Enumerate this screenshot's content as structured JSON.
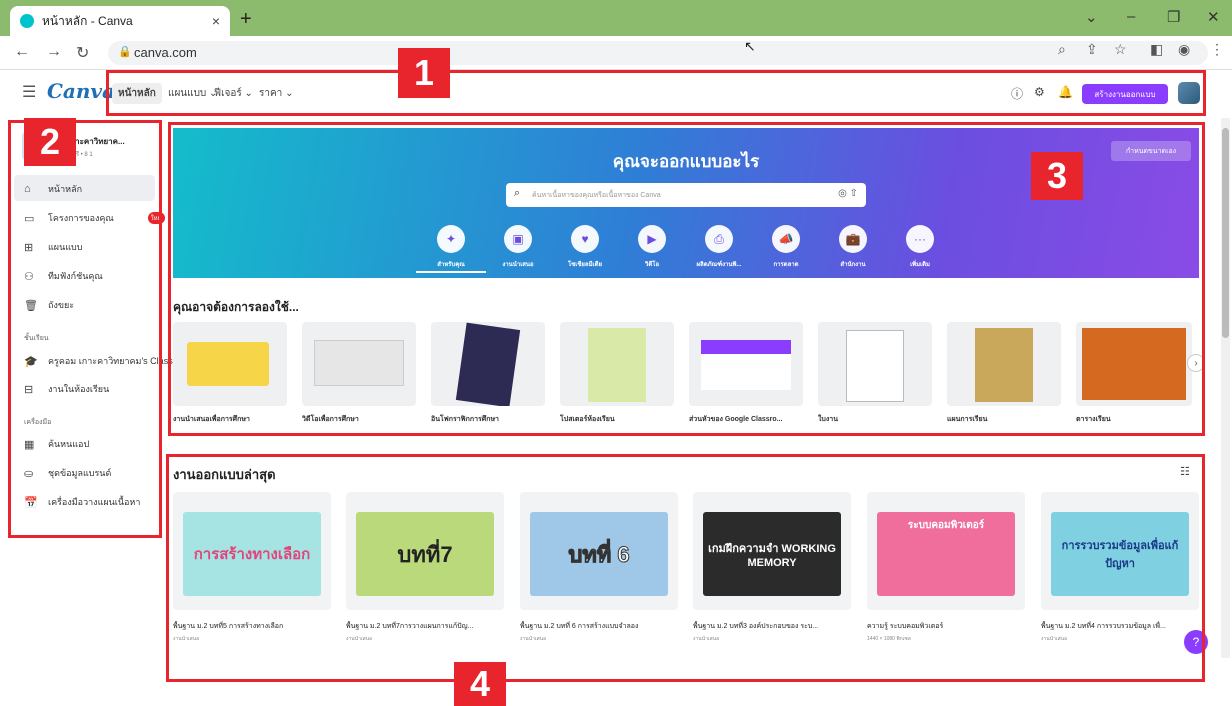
{
  "browser": {
    "tab_title": "หน้าหลัก - Canva",
    "tab_close": "×",
    "new_tab": "+",
    "url": "canva.com",
    "controls": [
      "⌄",
      "–",
      "❐",
      "✕"
    ]
  },
  "header": {
    "logo": "Canva",
    "nav": [
      {
        "label": "หน้าหลัก"
      },
      {
        "label": "แผนแบบ ⌄"
      },
      {
        "label": "ฟีเจอร์ ⌄"
      },
      {
        "label": "ราคา ⌄"
      }
    ],
    "create_button": "สร้างงานออกแบบ"
  },
  "annotations": [
    "1",
    "2",
    "3",
    "4"
  ],
  "sidebar": {
    "team_name": "ม เกาะคาวิทยาค...",
    "team_sub": "แผนฟรี • 8 1",
    "items": [
      {
        "label": "หน้าหลัก"
      },
      {
        "label": "โครงการของคุณ",
        "badge": "ใหม่"
      },
      {
        "label": "แผนแบบ"
      },
      {
        "label": "ทีมฟังก์ชันคุณ"
      },
      {
        "label": "ถังขยะ"
      }
    ],
    "section_class": "ชั้นเรียน",
    "class_items": [
      {
        "label": "ครูคอม เกาะคาวิทยาคม's Class"
      },
      {
        "label": "งานในห้องเรียน"
      }
    ],
    "section_tools": "เครื่องมือ",
    "tool_items": [
      {
        "label": "ค้นหนแอป"
      },
      {
        "label": "ชุดข้อมูลแบรนด์"
      },
      {
        "label": "เครื่องมือวางแผนเนื้อหา"
      }
    ]
  },
  "hero": {
    "title": "คุณจะออกแบบอะไร",
    "search_placeholder": "ค้นหาเนื้อหาของคุณหรือเนื้อหาของ Canva",
    "custom_size": "กำหนดขนาดเอง",
    "categories": [
      {
        "label": "สำหรับคุณ",
        "icon": "✦"
      },
      {
        "label": "งานนำเสนอ",
        "icon": "▣"
      },
      {
        "label": "โซเชียลมีเดีย",
        "icon": "♥"
      },
      {
        "label": "วิดีโอ",
        "icon": "▶"
      },
      {
        "label": "ผลิตภัณฑ์งานพิ...",
        "icon": "⎙"
      },
      {
        "label": "การตลาด",
        "icon": "📣"
      },
      {
        "label": "สำนักงาน",
        "icon": "💼"
      },
      {
        "label": "เพิ่มเติม",
        "icon": "···"
      }
    ]
  },
  "suggest": {
    "title": "คุณอาจต้องการลองใช้...",
    "cards": [
      {
        "label": "งานนำเสนอเพื่อการศึกษา"
      },
      {
        "label": "วิดีโอเพื่อการศึกษา"
      },
      {
        "label": "อินโฟกราฟิกการศึกษา"
      },
      {
        "label": "โปสเตอร์ห้องเรียน"
      },
      {
        "label": "ส่วนหัวของ Google Classro..."
      },
      {
        "label": "ใบงาน"
      },
      {
        "label": "แผนการเรียน"
      },
      {
        "label": "ตารางเรียน"
      }
    ]
  },
  "recent": {
    "title": "งานออกแบบล่าสุด",
    "items": [
      {
        "thumb": "การสร้างทางเลือก",
        "label": "พื้นฐาน ม.2 บทที่5 การสร้างทางเลือก",
        "sub": "งานนำเสนอ"
      },
      {
        "thumb": "บทที่7",
        "label": "พื้นฐาน ม.2 บทที่7การวางแผนการแก้ปัญ...",
        "sub": "งานนำเสนอ"
      },
      {
        "thumb": "บทที่ 6",
        "label": "พื้นฐาน ม.2 บทที่ 6 การสร้างแบบจำลอง",
        "sub": "งานนำเสนอ"
      },
      {
        "thumb": "เกมฝึกความจำ WORKING MEMORY",
        "label": "พื้นฐาน ม.2 บทที่3 องค์ประกอบของ ระบ...",
        "sub": "งานนำเสนอ"
      },
      {
        "thumb": "ระบบคอมพิวเตอร์",
        "label": "ความรู้ ระบบคอมพิวเตอร์",
        "sub": "1440 × 1080 พิกเซล"
      },
      {
        "thumb": "การรวบรวมข้อมูลเพื่อแก้ปัญหา",
        "label": "พื้นฐาน ม.2 บทที่4 การรวบรวมข้อมูล เพื่...",
        "sub": "งานนำเสนอ"
      }
    ]
  },
  "colors": {
    "accent": "#8b3dff",
    "annotation": "#e8242c",
    "browser_frame": "#8dbb6e"
  }
}
